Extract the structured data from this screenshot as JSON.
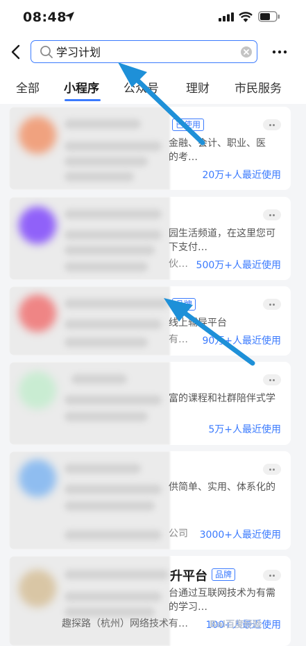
{
  "status": {
    "time": "08:48"
  },
  "search": {
    "value": "学习计划"
  },
  "tabs": [
    "全部",
    "小程序",
    "公众号",
    "理财",
    "市民服务"
  ],
  "cards": [
    {
      "desc1": "金融、会计、职业、医",
      "desc2": "的考…",
      "usage": "20万+人最近使用",
      "badge": "已使用"
    },
    {
      "desc1": "园生活频道，在这里您可",
      "desc2": "下支付…",
      "prefix": "伙…",
      "usage": "500万+人最近使用"
    },
    {
      "desc1": "线上辅导平台",
      "prefix": "有…",
      "usage": "90万+人最近使用",
      "badge": "品牌"
    },
    {
      "desc1": "富的课程和社群陪伴式学",
      "usage": "5万+人最近使用"
    },
    {
      "desc1": "供简单、实用、体系化的",
      "prefix": "公司",
      "usage": "3000+人最近使用"
    },
    {
      "title_tail": "升平台",
      "badge": "品牌",
      "desc1": "台通过互联网技术为有需",
      "desc2": "的学习…",
      "footer": "趣探路（杭州）网络技术有…",
      "usage": "100+人最近使用"
    }
  ],
  "watermark": "Bai百度经验",
  "colors": {
    "accent": "#3a7afe",
    "arrow": "#1e90d8"
  }
}
